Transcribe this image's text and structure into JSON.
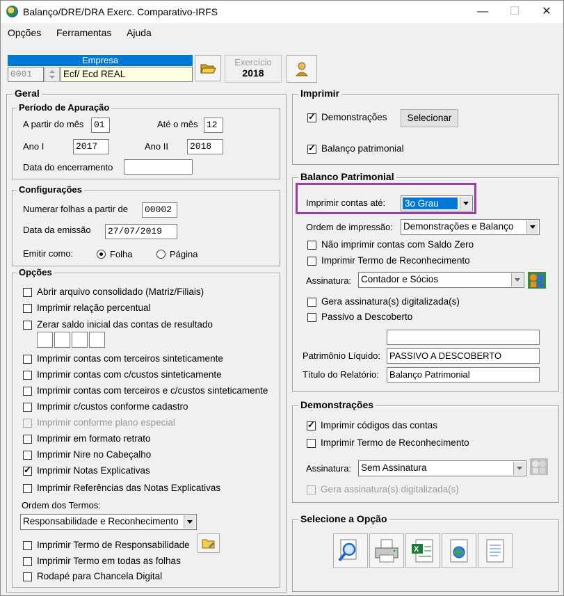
{
  "window": {
    "title": "Balanço/DRE/DRA Exerc. Comparativo-IRFS",
    "minimize": "—",
    "maximize": "☐",
    "close": "✕"
  },
  "menu": {
    "items": [
      "Opções",
      "Ferramentas",
      "Ajuda"
    ]
  },
  "empresa": {
    "header": "Empresa",
    "code": "0001",
    "name": "Ecf/ Ecd REAL",
    "exercicio_label": "Exercício",
    "exercicio_value": "2018"
  },
  "geral": {
    "title": "Geral",
    "periodo": {
      "title": "Período de Apuração",
      "a_partir_label": "A partir do mês",
      "a_partir_value": "01",
      "ate_label": "Até o mês",
      "ate_value": "12",
      "ano1_label": "Ano I",
      "ano1_value": "2017",
      "ano2_label": "Ano II",
      "ano2_value": "2018",
      "encerramento_label": "Data do encerramento",
      "encerramento_value": ""
    },
    "config": {
      "title": "Configurações",
      "numerar_label": "Numerar folhas a partir de",
      "numerar_value": "00002",
      "emissao_label": "Data da emissão",
      "emissao_value": "27/07/2019",
      "emitir_label": "Emitir como:",
      "folha": "Folha",
      "pagina": "Página"
    },
    "opcoes": {
      "title": "Opções",
      "items": [
        {
          "label": "Abrir arquivo consolidado (Matriz/Filiais)",
          "checked": false,
          "disabled": false
        },
        {
          "label": "Imprimir relação percentual",
          "checked": false,
          "disabled": false
        },
        {
          "label": "Zerar saldo inicial das contas de resultado",
          "checked": false,
          "disabled": false
        },
        {
          "label": "Imprimir contas com terceiros sinteticamente",
          "checked": false,
          "disabled": false
        },
        {
          "label": "Imprimir contas com c/custos sinteticamente",
          "checked": false,
          "disabled": false
        },
        {
          "label": "Imprimir contas com terceiros e c/custos sinteticamente",
          "checked": false,
          "disabled": false
        },
        {
          "label": "Imprimir c/custos conforme cadastro",
          "checked": false,
          "disabled": false
        },
        {
          "label": "Imprimir conforme plano especial",
          "checked": false,
          "disabled": true
        },
        {
          "label": "Imprimir em formato retrato",
          "checked": false,
          "disabled": false
        },
        {
          "label": "Imprimir Nire no Cabeçalho",
          "checked": false,
          "disabled": false
        },
        {
          "label": "Imprimir Notas Explicativas",
          "checked": true,
          "disabled": false
        },
        {
          "label": "Imprimir Referências das Notas Explicativas",
          "checked": false,
          "disabled": false
        }
      ],
      "ordem_label": "Ordem dos Termos:",
      "ordem_value": "Responsabilidade e Reconhecimento",
      "termo_resp": "Imprimir Termo de Responsabilidade",
      "termo_todas": "Imprimir Termo em todas as folhas",
      "rodape": "Rodapé para Chancela Digital"
    }
  },
  "imprimir": {
    "title": "Imprimir",
    "demonstracoes": "Demonstrações",
    "selecionar": "Selecionar",
    "balanco": "Balanço patrimonial"
  },
  "balanco_patrimonial": {
    "title": "Balanco Patrimonial",
    "imprimir_ate_label": "Imprimir contas até:",
    "imprimir_ate_value": "3o Grau",
    "highlight_color": "#9b3fa6",
    "ordem_label": "Ordem de impressão:",
    "ordem_value": "Demonstrações e Balanço",
    "nao_imprimir_zero": "Não imprimir contas com Saldo Zero",
    "termo_reconhecimento": "Imprimir Termo de Reconhecimento",
    "assinatura_label": "Assinatura:",
    "assinatura_value": "Contador e Sócios",
    "gera_assinatura": "Gera assinatura(s) digitalizada(s)",
    "passivo": "Passivo a Descoberto",
    "extra_value": "",
    "pl_label": "Patrimônio Líquido:",
    "pl_value": "PASSIVO A DESCOBERTO",
    "titulo_label": "Título do Relatório:",
    "titulo_value": "Balanço Patrimonial"
  },
  "demonstracoes": {
    "title": "Demonstrações",
    "codigos": "Imprimir códigos das contas",
    "termo": "Imprimir Termo de Reconhecimento",
    "assinatura_label": "Assinatura:",
    "assinatura_value": "Sem Assinatura",
    "gera": "Gera assinatura(s) digitalizada(s)"
  },
  "selecione": {
    "title": "Selecione a Opção"
  }
}
